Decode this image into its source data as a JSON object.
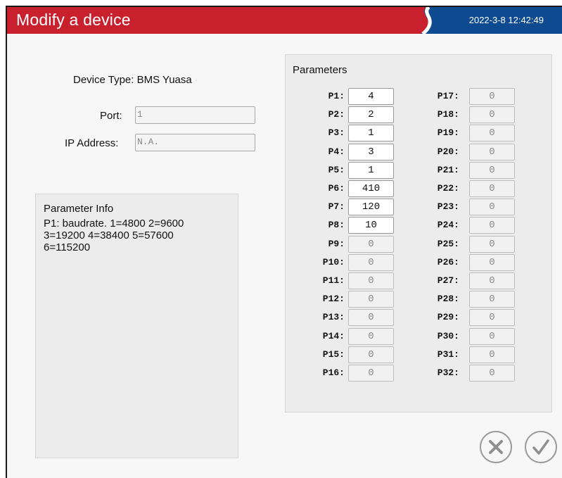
{
  "window": {
    "title": "Modify a device",
    "datetime": "2022-3-8 12:42:49",
    "colors": {
      "title_red": "#c8202c",
      "title_blue": "#0d4a8f"
    }
  },
  "device": {
    "type_label": "Device Type:",
    "type_value": "BMS Yuasa",
    "port_label": "Port:",
    "port_value": "1",
    "ip_label": "IP Address:",
    "ip_value": "N.A."
  },
  "parameter_info": {
    "title": "Parameter Info",
    "text": "P1: baudrate. 1=4800 2=9600\n3=19200 4=38400 5=57600\n6=115200"
  },
  "parameters": {
    "title": "Parameters",
    "items": [
      {
        "name": "P1",
        "value": "4",
        "enabled": true
      },
      {
        "name": "P2",
        "value": "2",
        "enabled": true
      },
      {
        "name": "P3",
        "value": "1",
        "enabled": true
      },
      {
        "name": "P4",
        "value": "3",
        "enabled": true
      },
      {
        "name": "P5",
        "value": "1",
        "enabled": true
      },
      {
        "name": "P6",
        "value": "410",
        "enabled": true
      },
      {
        "name": "P7",
        "value": "120",
        "enabled": true
      },
      {
        "name": "P8",
        "value": "10",
        "enabled": true
      },
      {
        "name": "P9",
        "value": "0",
        "enabled": false
      },
      {
        "name": "P10",
        "value": "0",
        "enabled": false
      },
      {
        "name": "P11",
        "value": "0",
        "enabled": false
      },
      {
        "name": "P12",
        "value": "0",
        "enabled": false
      },
      {
        "name": "P13",
        "value": "0",
        "enabled": false
      },
      {
        "name": "P14",
        "value": "0",
        "enabled": false
      },
      {
        "name": "P15",
        "value": "0",
        "enabled": false
      },
      {
        "name": "P16",
        "value": "0",
        "enabled": false
      },
      {
        "name": "P17",
        "value": "0",
        "enabled": false
      },
      {
        "name": "P18",
        "value": "0",
        "enabled": false
      },
      {
        "name": "P19",
        "value": "0",
        "enabled": false
      },
      {
        "name": "P20",
        "value": "0",
        "enabled": false
      },
      {
        "name": "P21",
        "value": "0",
        "enabled": false
      },
      {
        "name": "P22",
        "value": "0",
        "enabled": false
      },
      {
        "name": "P23",
        "value": "0",
        "enabled": false
      },
      {
        "name": "P24",
        "value": "0",
        "enabled": false
      },
      {
        "name": "P25",
        "value": "0",
        "enabled": false
      },
      {
        "name": "P26",
        "value": "0",
        "enabled": false
      },
      {
        "name": "P27",
        "value": "0",
        "enabled": false
      },
      {
        "name": "P28",
        "value": "0",
        "enabled": false
      },
      {
        "name": "P29",
        "value": "0",
        "enabled": false
      },
      {
        "name": "P30",
        "value": "0",
        "enabled": false
      },
      {
        "name": "P31",
        "value": "0",
        "enabled": false
      },
      {
        "name": "P32",
        "value": "0",
        "enabled": false
      }
    ]
  },
  "actions": {
    "cancel_icon": "close-circle-icon",
    "confirm_icon": "check-circle-icon"
  }
}
